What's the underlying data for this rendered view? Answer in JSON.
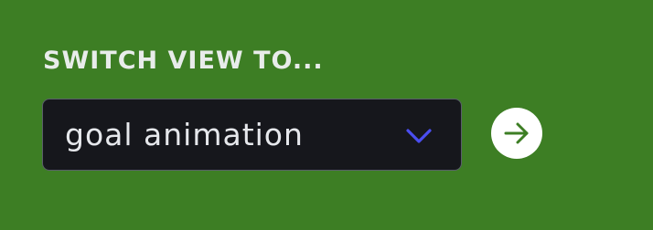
{
  "view_switcher": {
    "heading": "SWITCH VIEW TO...",
    "select": {
      "selected_value": "goal animation",
      "chevron_icon": "chevron-down-icon"
    },
    "go_button": {
      "icon": "arrow-right-icon"
    }
  },
  "colors": {
    "background": "#3d7e24",
    "select_background": "#16171c",
    "chevron": "#4a4ef0",
    "arrow": "#3d7e24",
    "button_background": "#ffffff",
    "text": "#e8ecea"
  }
}
